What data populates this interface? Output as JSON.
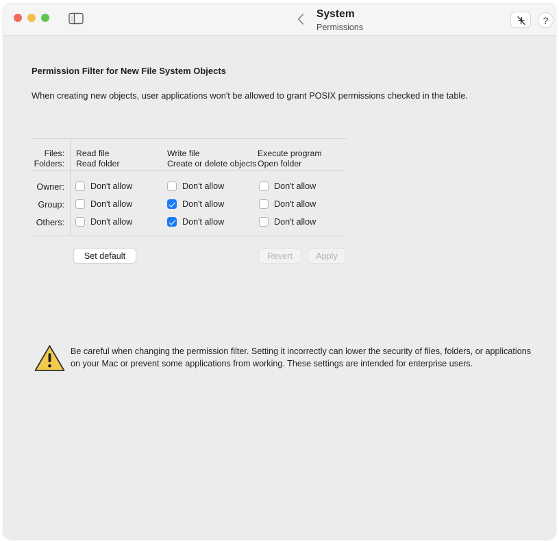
{
  "window": {
    "traffic_lights": [
      "close",
      "minimize",
      "zoom"
    ],
    "sidebar_toggle_icon": "sidebar-toggle-icon",
    "back_icon": "chevron-left-icon",
    "title": "System",
    "subtitle": "Permissions",
    "collapse_icon": "collapse-arrows-icon",
    "help_label": "?",
    "colors": {
      "titlebar_bg": "#F5F5F5",
      "content_bg": "#ECECEC",
      "close": "#EC6A5E",
      "minimize": "#F4BD4F",
      "zoom": "#61C554",
      "checkbox_checked": "#1A7BFB",
      "warning_fill": "#F2CA4C"
    }
  },
  "section": {
    "title": "Permission Filter for New File System Objects",
    "description": "When creating new objects, user applications won't be allowed to grant POSIX permissions checked in the table."
  },
  "table": {
    "corner": {
      "line1": "Files:",
      "line2": "Folders:"
    },
    "columns": [
      {
        "file": "Read file",
        "folder": "Read folder"
      },
      {
        "file": "Write file",
        "folder": "Create or delete objects"
      },
      {
        "file": "Execute program",
        "folder": "Open folder"
      }
    ],
    "checkbox_label": "Don't allow",
    "rows": [
      {
        "label": "Owner:",
        "checked": [
          false,
          false,
          false
        ]
      },
      {
        "label": "Group:",
        "checked": [
          false,
          true,
          false
        ]
      },
      {
        "label": "Others:",
        "checked": [
          false,
          true,
          false
        ]
      }
    ]
  },
  "buttons": {
    "set_default": "Set default",
    "revert": "Revert",
    "apply": "Apply"
  },
  "warning": {
    "icon": "warning-triangle-icon",
    "text": "Be careful when changing the permission filter. Setting it incorrectly can lower the security of files, folders, or applications on your Mac or prevent some applications from working. These settings are intended for enterprise users."
  }
}
